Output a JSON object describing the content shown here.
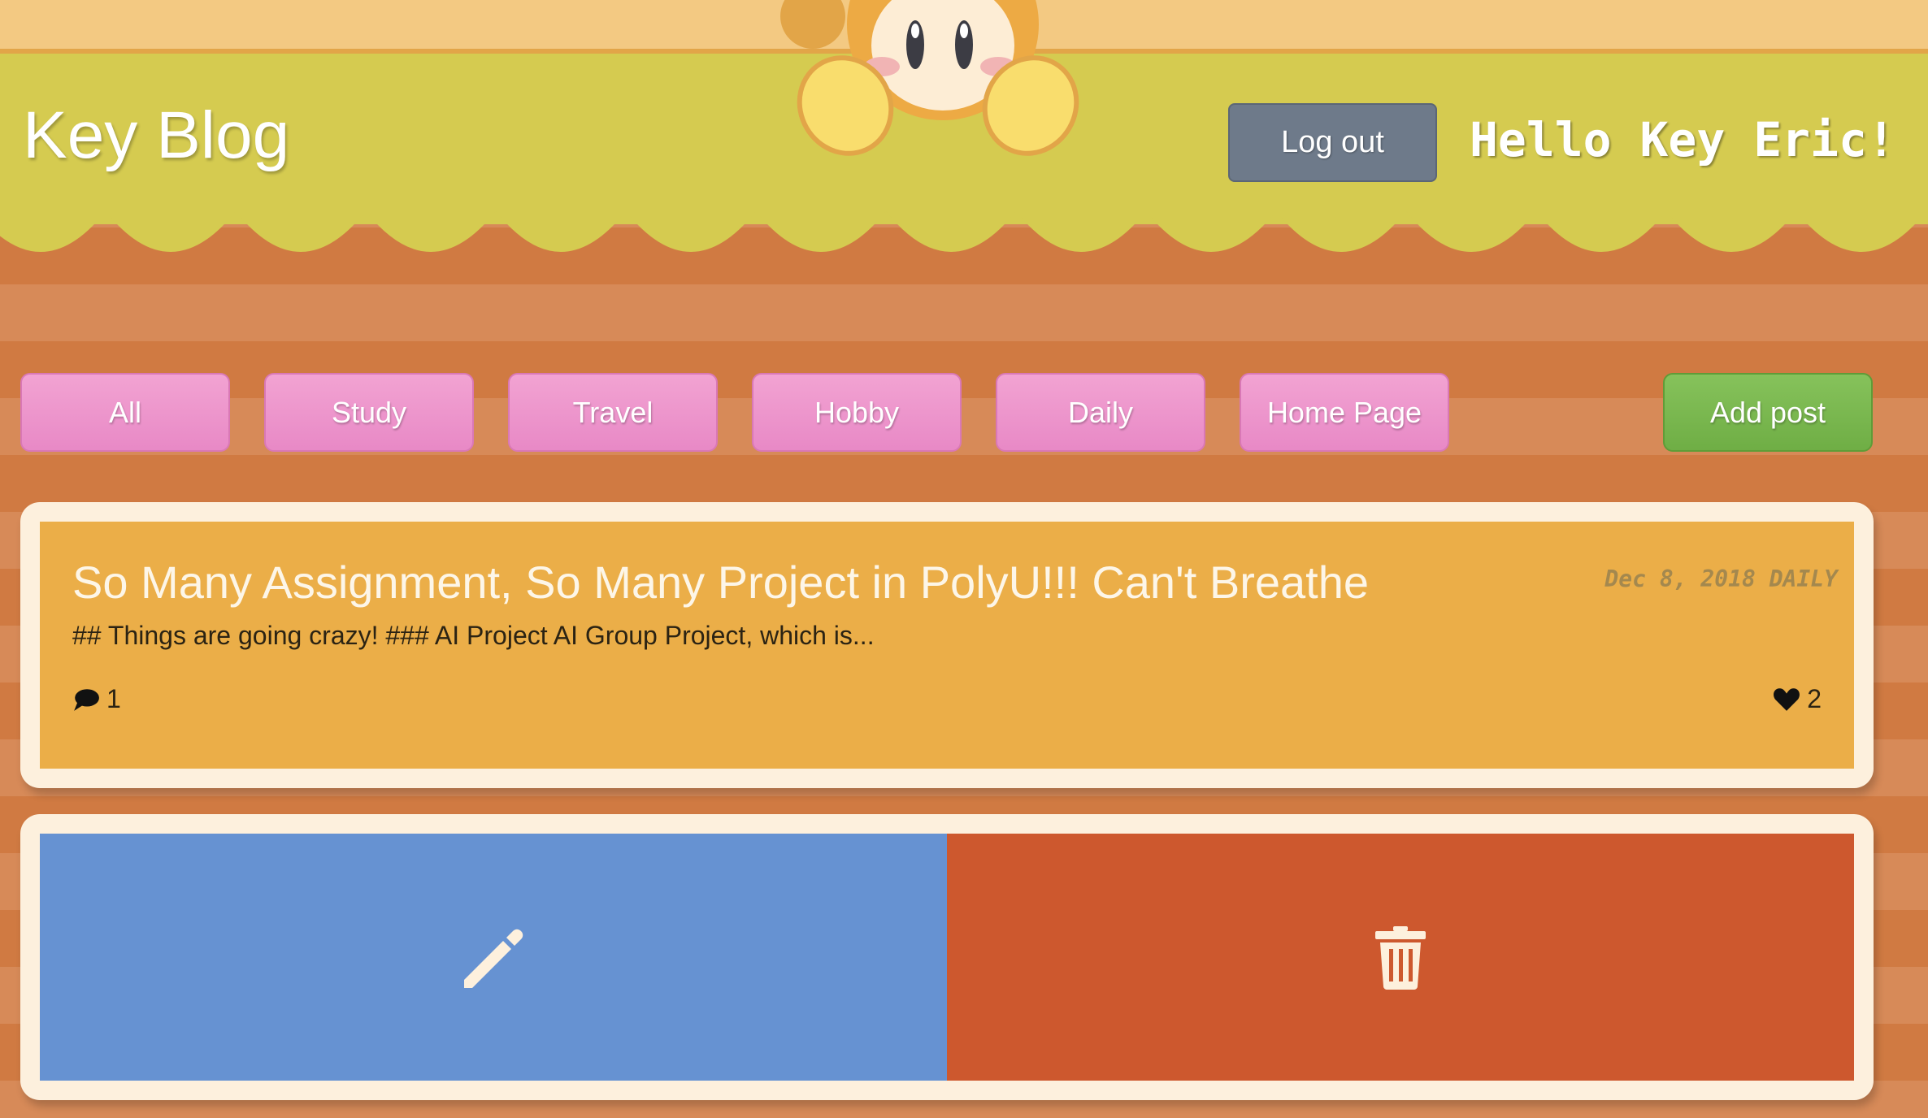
{
  "header": {
    "site_title": "Key Blog",
    "logout_label": "Log out",
    "greeting": "Hello Key Eric!"
  },
  "nav": {
    "categories": [
      "All",
      "Study",
      "Travel",
      "Hobby",
      "Daily",
      "Home Page"
    ],
    "add_post_label": "Add post"
  },
  "post": {
    "title": "So Many Assignment, So Many Project in PolyU!!! Can't Breathe",
    "date": "Dec 8, 2018",
    "category": "DAILY",
    "excerpt": "## Things are going crazy! ### AI Project AI Group Project, which is...",
    "comment_count": "1",
    "like_count": "2"
  },
  "actions": {
    "edit_icon": "pencil-icon",
    "delete_icon": "trash-icon"
  },
  "colors": {
    "header": "#d5cb50",
    "category_button": "#ec96cc",
    "add_button": "#7bb850",
    "post_card": "#ebae48",
    "edit": "#6692d2",
    "delete": "#cd582e",
    "logout": "#6e7a8a"
  }
}
